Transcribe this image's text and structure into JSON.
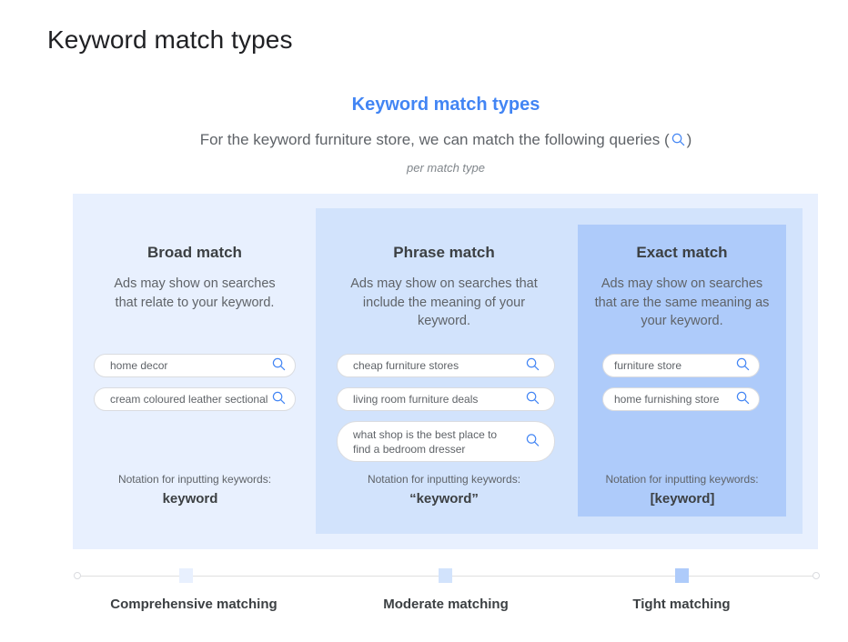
{
  "page_title": "Keyword match types",
  "diagram": {
    "title": "Keyword match types",
    "subtitle_before": "For the keyword furniture store, we can match the following queries (",
    "subtitle_after": ")",
    "subtitle_icon": "search-icon",
    "note": "per match type",
    "colors": {
      "accent": "#4285f4",
      "broad_bg": "#e8f0fe",
      "phrase_bg": "#d2e3fc",
      "exact_bg": "#aecbfa"
    },
    "columns": [
      {
        "title": "Broad match",
        "description": "Ads may show on searches that relate to your keyword.",
        "queries": [
          "home decor",
          "cream coloured leather sectional"
        ],
        "notation_label": "Notation for inputting keywords:",
        "notation": "keyword"
      },
      {
        "title": "Phrase match",
        "description": "Ads may show on searches that include the meaning of your keyword.",
        "queries": [
          "cheap furniture stores",
          "living room furniture deals",
          "what shop is the best place to find a bedroom dresser"
        ],
        "notation_label": "Notation for inputting keywords:",
        "notation": "“keyword”"
      },
      {
        "title": "Exact match",
        "description": "Ads may show on searches that are the same meaning as your keyword.",
        "queries": [
          "furniture store",
          "home furnishing store"
        ],
        "notation_label": "Notation for inputting keywords:",
        "notation": "[keyword]"
      }
    ],
    "scale": [
      {
        "label": "Comprehensive matching",
        "color": "#e8f0fe"
      },
      {
        "label": "Moderate matching",
        "color": "#d2e3fc"
      },
      {
        "label": "Tight matching",
        "color": "#aecbfa"
      }
    ]
  }
}
